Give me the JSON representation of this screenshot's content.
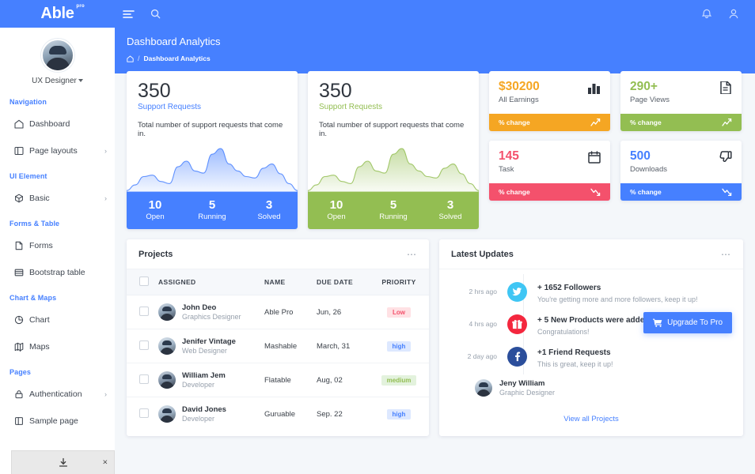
{
  "brand": {
    "name": "Able",
    "sup": "pro"
  },
  "topbar": {
    "menu_icon": "hamburger-icon",
    "search_icon": "search-icon",
    "bell_icon": "bell-icon",
    "user_icon": "user-icon"
  },
  "sidebar": {
    "profile": {
      "role": "UX Designer",
      "avatar": "user-avatar"
    },
    "groups": [
      {
        "caption": "Navigation",
        "items": [
          {
            "label": "Dashboard",
            "icon": "home-icon",
            "arrow": ""
          },
          {
            "label": "Page layouts",
            "icon": "layout-icon",
            "arrow": "›"
          }
        ]
      },
      {
        "caption": "UI Element",
        "items": [
          {
            "label": "Basic",
            "icon": "cube-icon",
            "arrow": "›"
          }
        ]
      },
      {
        "caption": "Forms & Table",
        "items": [
          {
            "label": "Forms",
            "icon": "form-icon",
            "arrow": ""
          },
          {
            "label": "Bootstrap table",
            "icon": "table-icon",
            "arrow": ""
          }
        ]
      },
      {
        "caption": "Chart & Maps",
        "items": [
          {
            "label": "Chart",
            "icon": "pie-chart-icon",
            "arrow": ""
          },
          {
            "label": "Maps",
            "icon": "map-icon",
            "arrow": ""
          }
        ]
      },
      {
        "caption": "Pages",
        "items": [
          {
            "label": "Authentication",
            "icon": "lock-icon",
            "arrow": "›"
          },
          {
            "label": "Sample page",
            "icon": "page-icon",
            "arrow": ""
          }
        ]
      }
    ],
    "download_toast": {
      "icon": "download-icon",
      "close": "×"
    }
  },
  "page": {
    "title": "Dashboard Analytics",
    "breadcrumb_home_icon": "home-icon",
    "breadcrumb_sep": "/",
    "breadcrumb_current": "Dashboard Analytics"
  },
  "support_cards": [
    {
      "number": "350",
      "subtitle": "Support Requests",
      "description": "Total number of support requests that come in.",
      "accent": "#4680ff",
      "stats": [
        {
          "value": "10",
          "label": "Open"
        },
        {
          "value": "5",
          "label": "Running"
        },
        {
          "value": "3",
          "label": "Solved"
        }
      ]
    },
    {
      "number": "350",
      "subtitle": "Support Requests",
      "description": "Total number of support requests that come in.",
      "accent": "#93be52",
      "stats": [
        {
          "value": "10",
          "label": "Open"
        },
        {
          "value": "5",
          "label": "Running"
        },
        {
          "value": "3",
          "label": "Solved"
        }
      ]
    }
  ],
  "mini_cards": [
    {
      "value": "$30200",
      "label": "All Earnings",
      "icon": "bar-chart-icon",
      "color": "#f5a623",
      "foot_label": "% change",
      "trend": "up"
    },
    {
      "value": "290+",
      "label": "Page Views",
      "icon": "document-icon",
      "color": "#93be52",
      "foot_label": "% change",
      "trend": "up"
    },
    {
      "value": "145",
      "label": "Task",
      "icon": "calendar-icon",
      "color": "#f4516c",
      "foot_label": "% change",
      "trend": "down"
    },
    {
      "value": "500",
      "label": "Downloads",
      "icon": "thumbs-down-icon",
      "color": "#4680ff",
      "foot_label": "% change",
      "trend": "down"
    }
  ],
  "projects": {
    "title": "Projects",
    "more_icon": "more-options-icon",
    "columns": [
      "ASSIGNED",
      "NAME",
      "DUE DATE",
      "PRIORITY"
    ],
    "rows": [
      {
        "name": "John Deo",
        "role": "Graphics Designer",
        "project": "Able Pro",
        "due": "Jun, 26",
        "priority": "Low",
        "priority_class": "b-low"
      },
      {
        "name": "Jenifer Vintage",
        "role": "Web Designer",
        "project": "Mashable",
        "due": "March, 31",
        "priority": "high",
        "priority_class": "b-high"
      },
      {
        "name": "William Jem",
        "role": "Developer",
        "project": "Flatable",
        "due": "Aug, 02",
        "priority": "medium",
        "priority_class": "b-med"
      },
      {
        "name": "David Jones",
        "role": "Developer",
        "project": "Guruable",
        "due": "Sep. 22",
        "priority": "high",
        "priority_class": "b-high"
      }
    ]
  },
  "latest_updates": {
    "title": "Latest Updates",
    "more_icon": "more-options-icon",
    "items": [
      {
        "time": "2 hrs ago",
        "icon": "twitter-icon",
        "color": "#3fc6f4",
        "title": "+ 1652 Followers",
        "desc": "You're getting more and more followers, keep it up!"
      },
      {
        "time": "4 hrs ago",
        "icon": "gift-icon",
        "color": "#f4273e",
        "title": "+ 5 New Products were added!",
        "desc": "Congratulations!"
      },
      {
        "time": "2 day ago",
        "icon": "facebook-icon",
        "color": "#2b4e9b",
        "title": "+1 Friend Requests",
        "desc": "This is great, keep it up!"
      }
    ],
    "person": {
      "name": "Jeny William",
      "role": "Graphic Designer",
      "avatar": "user-avatar"
    },
    "view_all": "View all Projects"
  },
  "upgrade_button": {
    "label": "Upgrade To Pro",
    "icon": "cart-icon"
  },
  "chart_data": [
    {
      "type": "area",
      "title": "Support Requests",
      "series": [
        {
          "name": "Requests",
          "values": [
            2,
            10,
            22,
            24,
            15,
            12,
            36,
            44,
            30,
            27,
            54,
            62,
            40,
            30,
            22,
            20,
            34,
            40,
            26,
            12,
            2
          ]
        }
      ],
      "x": [
        0,
        1,
        2,
        3,
        4,
        5,
        6,
        7,
        8,
        9,
        10,
        11,
        12,
        13,
        14,
        15,
        16,
        17,
        18,
        19,
        20
      ],
      "ylim": [
        0,
        70
      ],
      "grid": false,
      "legend": "none",
      "color": "#4680ff"
    },
    {
      "type": "area",
      "title": "Support Requests",
      "series": [
        {
          "name": "Requests",
          "values": [
            2,
            10,
            22,
            24,
            15,
            12,
            36,
            44,
            30,
            27,
            54,
            62,
            40,
            30,
            22,
            20,
            34,
            40,
            26,
            12,
            2
          ]
        }
      ],
      "x": [
        0,
        1,
        2,
        3,
        4,
        5,
        6,
        7,
        8,
        9,
        10,
        11,
        12,
        13,
        14,
        15,
        16,
        17,
        18,
        19,
        20
      ],
      "ylim": [
        0,
        70
      ],
      "grid": false,
      "legend": "none",
      "color": "#93be52"
    }
  ]
}
